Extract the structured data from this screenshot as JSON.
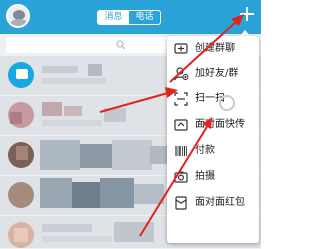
{
  "header": {
    "tabs": [
      {
        "label": "消息",
        "active": true
      },
      {
        "label": "电话",
        "active": false
      }
    ],
    "plus_icon": "plus-icon",
    "avatar_icon": "user-avatar"
  },
  "search": {
    "icon": "search-icon"
  },
  "menu": {
    "items": [
      {
        "label": "创建群聊",
        "icon": "group-chat-icon"
      },
      {
        "label": "加好友/群",
        "icon": "add-friend-icon"
      },
      {
        "label": "扫一扫",
        "icon": "scan-icon"
      },
      {
        "label": "面对面快传",
        "icon": "face-transfer-icon"
      },
      {
        "label": "付款",
        "icon": "payment-icon"
      },
      {
        "label": "拍摄",
        "icon": "camera-icon"
      },
      {
        "label": "面对面红包",
        "icon": "red-envelope-icon"
      }
    ]
  },
  "colors": {
    "header_bg": "#2aa3d8",
    "annotation_arrow": "#e0231e",
    "menu_bg": "#ffffff"
  }
}
